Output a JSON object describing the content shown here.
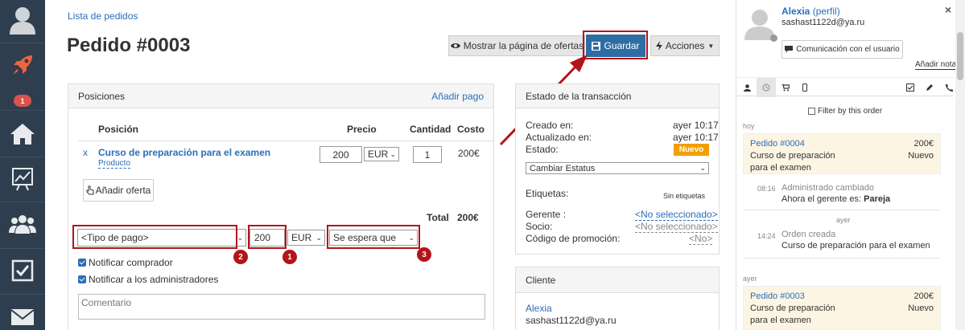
{
  "colors": {
    "sidebar_bg": "#2e3e4e",
    "accent": "#2a6ebb",
    "save_button": "#2e6da4",
    "annotation_red": "#b3141a",
    "status_orange": "#f0a000",
    "card_bg": "#fdf5e4"
  },
  "sidebar": {
    "items": [
      {
        "icon": "user-icon"
      },
      {
        "icon": "rocket-icon"
      },
      {
        "icon": "home-icon",
        "badge": "1"
      },
      {
        "icon": "chart-icon"
      },
      {
        "icon": "users-icon"
      },
      {
        "icon": "checkbox-icon"
      },
      {
        "icon": "mail-icon"
      }
    ]
  },
  "header": {
    "breadcrumb": "Lista de pedidos",
    "title": "Pedido #0003",
    "show_offers_label": "Mostrar la página de ofertas",
    "save_label": "Guardar",
    "actions_label": "Acciones"
  },
  "positions": {
    "title": "Posiciones",
    "add_payment": "Añadir pago",
    "columns": [
      "Posición",
      "Precio",
      "Cantidad",
      "Costo"
    ],
    "row": {
      "remove": "x",
      "name": "Curso de preparación para el examen",
      "type": "Producto",
      "price": "200",
      "currency": "EUR",
      "quantity": "1",
      "cost": "200€"
    },
    "add_offer": "Añadir oferta",
    "total_label": "Total",
    "total_value": "200€",
    "payment_type": "<Tipo de pago>",
    "payment_amount": "200",
    "payment_currency": "EUR",
    "payment_status": "Se espera que",
    "badges": [
      "2",
      "1",
      "3"
    ],
    "notify_buyer": "Notificar comprador",
    "notify_admins": "Notificar a los administradores",
    "comment_placeholder": "Comentario"
  },
  "transaction": {
    "title": "Estado de la transacción",
    "created_label": "Creado en:",
    "created_value": "ayer 10:17",
    "updated_label": "Actualizado en:",
    "updated_value": "ayer 10:17",
    "status_label": "Estado:",
    "status_value": "Nuevo",
    "change_status": "Cambiar Estatus",
    "tags_label": "Etiquetas:",
    "tags_value": "Sin etiquetas",
    "manager_label": "Gerente :",
    "manager_value": "<No seleccionado>",
    "partner_label": "Socio:",
    "partner_value": "<No seleccionado>",
    "promo_label": "Código de promoción:",
    "promo_value": "<No>"
  },
  "client": {
    "title": "Cliente",
    "name": "Alexia",
    "email": "sashast1122d@ya.ru"
  },
  "user_panel": {
    "name": "Alexia",
    "profile": "(perfil)",
    "email": "sashast1122d@ya.ru",
    "communicate": "Comunicación con el usuario",
    "add_note": "Añadir nota",
    "close": "×",
    "filter_label": "Filter by this order",
    "tabs": [
      "user-icon",
      "history-icon",
      "cart-icon",
      "mobile-icon",
      "checklist-icon",
      "pencil-icon",
      "phone-icon"
    ]
  },
  "feed": {
    "today_label": "hoy",
    "order1": {
      "title": "Pedido #0004",
      "amount": "200€",
      "desc": "Curso de preparación para el examen",
      "status": "Nuevo"
    },
    "log1": {
      "time": "08:16",
      "title": "Administrado cambiado",
      "text_prefix": "Ahora el gerente es:",
      "text_bold": "Pareja"
    },
    "yesterday_inline": "ayer",
    "log2": {
      "time": "14:24",
      "title": "Orden creada",
      "text": "Curso de preparación para el examen"
    },
    "yesterday_label": "ayer",
    "order2": {
      "title": "Pedido #0003",
      "amount": "200€",
      "desc": "Curso de preparación para el examen",
      "status": "Nuevo"
    }
  }
}
